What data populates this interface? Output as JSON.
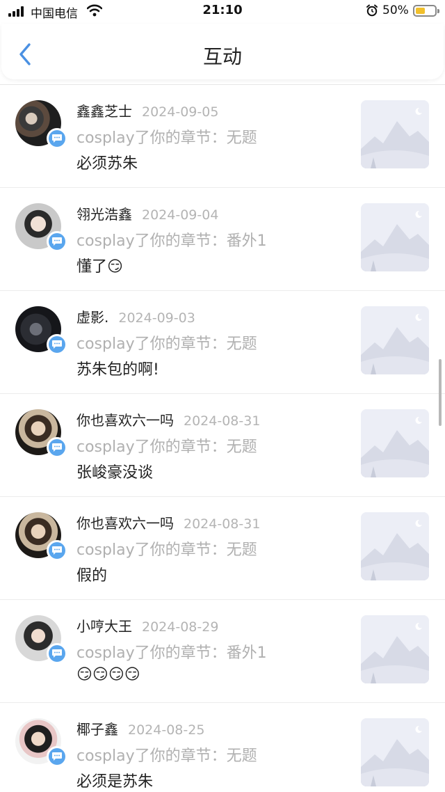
{
  "status_bar": {
    "carrier": "中国电信",
    "time": "21:10",
    "battery_percent": "50%",
    "battery_level": 0.5,
    "icons": [
      "signal-icon",
      "wifi-icon",
      "alarm-icon",
      "battery-icon"
    ]
  },
  "nav": {
    "title": "互动",
    "back_icon": "chevron-left-icon"
  },
  "colors": {
    "accent": "#4a90e2",
    "badge": "#5aa6ee",
    "battery_fill": "#f1c02c",
    "muted_text": "#b0b0b0"
  },
  "items": [
    {
      "name": "鑫鑫芝士",
      "date": "2024-09-05",
      "action": "cosplay了你的章节：无题",
      "comment": "必须苏朱"
    },
    {
      "name": "翎光浩鑫",
      "date": "2024-09-04",
      "action": "cosplay了你的章节：番外1",
      "comment": "懂了😏"
    },
    {
      "name": "虚影.",
      "date": "2024-09-03",
      "action": "cosplay了你的章节：无题",
      "comment": "苏朱包的啊!"
    },
    {
      "name": "你也喜欢六一吗",
      "date": "2024-08-31",
      "action": "cosplay了你的章节：无题",
      "comment": "张峻豪没谈"
    },
    {
      "name": "你也喜欢六一吗",
      "date": "2024-08-31",
      "action": "cosplay了你的章节：无题",
      "comment": "假的"
    },
    {
      "name": "小哼大王",
      "date": "2024-08-29",
      "action": "cosplay了你的章节：番外1",
      "comment": "😏😏😏😏"
    },
    {
      "name": "椰子鑫",
      "date": "2024-08-25",
      "action": "cosplay了你的章节：无题",
      "comment": "必须是苏朱"
    }
  ]
}
